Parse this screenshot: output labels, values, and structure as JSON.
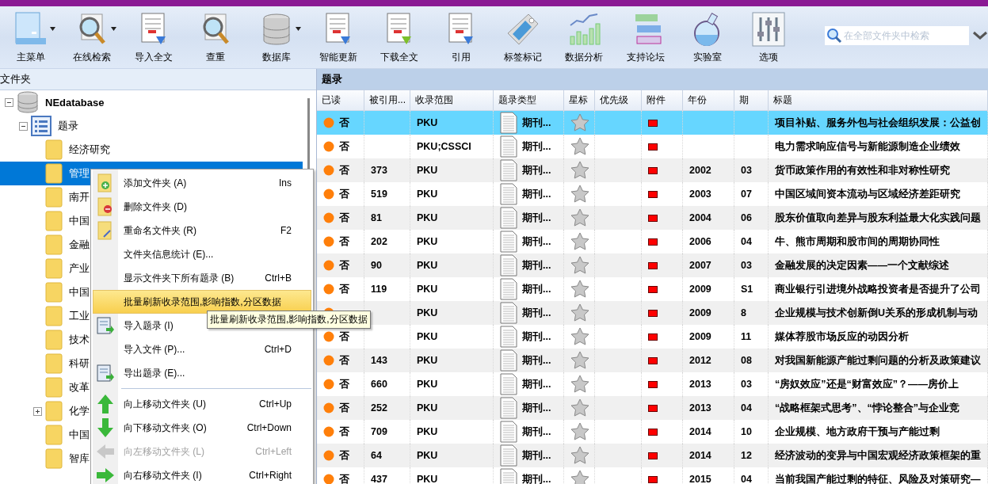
{
  "toolbar": {
    "buttons": [
      {
        "label": "主菜单",
        "dropdown": true
      },
      {
        "label": "在线检索",
        "dropdown": true
      },
      {
        "label": "导入全文",
        "dropdown": false
      },
      {
        "label": "查重",
        "dropdown": false
      },
      {
        "label": "数据库",
        "dropdown": true
      },
      {
        "label": "智能更新",
        "dropdown": false
      },
      {
        "label": "下载全文",
        "dropdown": false
      },
      {
        "label": "引用",
        "dropdown": false
      },
      {
        "label": "标签标记",
        "dropdown": false
      },
      {
        "label": "数据分析",
        "dropdown": false
      },
      {
        "label": "支持论坛",
        "dropdown": false
      },
      {
        "label": "实验室",
        "dropdown": false
      },
      {
        "label": "选项",
        "dropdown": false
      }
    ],
    "search": {
      "placeholder": "在全部文件夹中检索"
    }
  },
  "folder_panel": {
    "title": "文件夹",
    "tree": [
      {
        "label": "NEdatabase",
        "expanded": true,
        "selected": false,
        "children": [
          {
            "label": "题录",
            "expanded": true,
            "selected": false,
            "children": [
              {
                "label": "经济研究",
                "selected": false
              },
              {
                "label": "管理",
                "selected": true
              },
              {
                "label": "南开",
                "selected": false
              },
              {
                "label": "中国",
                "selected": false
              },
              {
                "label": "金融",
                "selected": false
              },
              {
                "label": "产业",
                "selected": false
              },
              {
                "label": "中国",
                "selected": false
              },
              {
                "label": "工业",
                "selected": false
              },
              {
                "label": "技术",
                "selected": false
              },
              {
                "label": "科研",
                "selected": false
              },
              {
                "label": "改革",
                "selected": false
              },
              {
                "label": "化学",
                "expanded": false,
                "selected": false
              },
              {
                "label": "中国",
                "selected": false
              },
              {
                "label": "智库",
                "selected": false
              }
            ]
          }
        ]
      }
    ]
  },
  "context_menu": {
    "items": [
      {
        "kind": "item",
        "label": "添加文件夹 (A)",
        "shortcut": "Ins",
        "selected": false,
        "disabled": false
      },
      {
        "kind": "item",
        "label": "删除文件夹 (D)",
        "selected": false,
        "disabled": false
      },
      {
        "kind": "item",
        "label": "重命名文件夹 (R)",
        "shortcut": "F2",
        "selected": false,
        "disabled": false
      },
      {
        "kind": "item",
        "label": "文件夹信息统计 (E)...",
        "selected": false,
        "disabled": false
      },
      {
        "kind": "item",
        "label": "显示文件夹下所有题录 (B)",
        "shortcut": "Ctrl+B",
        "selected": false,
        "disabled": false
      },
      {
        "kind": "item",
        "label": "批量刷新收录范围,影响指数,分区数据",
        "selected": true,
        "disabled": false
      },
      {
        "kind": "item",
        "label": "导入题录 (I)",
        "selected": false,
        "disabled": false
      },
      {
        "kind": "item",
        "label": "导入文件 (P)...",
        "shortcut": "Ctrl+D",
        "selected": false,
        "disabled": false
      },
      {
        "kind": "item",
        "label": "导出题录 (E)...",
        "selected": false,
        "disabled": false
      },
      {
        "kind": "separator"
      },
      {
        "kind": "item",
        "label": "向上移动文件夹 (U)",
        "shortcut": "Ctrl+Up",
        "selected": false,
        "disabled": false
      },
      {
        "kind": "item",
        "label": "向下移动文件夹 (O)",
        "shortcut": "Ctrl+Down",
        "selected": false,
        "disabled": false
      },
      {
        "kind": "item",
        "label": "向左移动文件夹 (L)",
        "shortcut": "Ctrl+Left",
        "selected": false,
        "disabled": true
      },
      {
        "kind": "item",
        "label": "向右移动文件夹 (I)",
        "shortcut": "Ctrl+Right",
        "selected": false,
        "disabled": false
      }
    ]
  },
  "tooltip": {
    "text": "批量刷新收录范围,影响指数,分区数据"
  },
  "records": {
    "title": "题录",
    "columns": [
      "已读",
      "被引用...",
      "收录范围",
      "题录类型",
      "星标",
      "优先级",
      "附件",
      "年份",
      "期",
      "标题"
    ],
    "rows": [
      {
        "read": "否",
        "scope": "PKU",
        "type": "期刊...",
        "starred": false,
        "attachment": true,
        "title": "项目补贴、服务外包与社会组织发展：公益创",
        "selected": true
      },
      {
        "read": "否",
        "scope": "PKU;CSSCI",
        "type": "期刊...",
        "starred": false,
        "attachment": true,
        "title": "电力需求响应信号与新能源制造企业绩效",
        "selected": false
      },
      {
        "read": "否",
        "cited": "373",
        "scope": "PKU",
        "type": "期刊...",
        "starred": false,
        "attachment": true,
        "year": "2002",
        "issue": "03",
        "title": "货币政策作用的有效性和非对称性研究",
        "selected": false
      },
      {
        "read": "否",
        "cited": "519",
        "scope": "PKU",
        "type": "期刊...",
        "starred": false,
        "attachment": true,
        "year": "2003",
        "issue": "07",
        "title": "中国区域间资本流动与区域经济差距研究",
        "selected": false
      },
      {
        "read": "否",
        "cited": "81",
        "scope": "PKU",
        "type": "期刊...",
        "starred": false,
        "attachment": true,
        "year": "2004",
        "issue": "06",
        "title": "股东价值取向差异与股东利益最大化实践问题",
        "selected": false
      },
      {
        "read": "否",
        "cited": "202",
        "scope": "PKU",
        "type": "期刊...",
        "starred": false,
        "attachment": true,
        "year": "2006",
        "issue": "04",
        "title": "牛、熊市周期和股市间的周期协同性",
        "selected": false
      },
      {
        "read": "否",
        "cited": "90",
        "scope": "PKU",
        "type": "期刊...",
        "starred": false,
        "attachment": true,
        "year": "2007",
        "issue": "03",
        "title": "金融发展的决定因素——一个文献综述",
        "selected": false
      },
      {
        "read": "否",
        "cited": "119",
        "scope": "PKU",
        "type": "期刊...",
        "starred": false,
        "attachment": true,
        "year": "2009",
        "issue": "S1",
        "title": "商业银行引进境外战略投资者是否提升了公司",
        "selected": false
      },
      {
        "scope": "PKU",
        "type": "期刊...",
        "starred": false,
        "attachment": true,
        "year": "2009",
        "issue": "8",
        "title": "企业规模与技术创新倒U关系的形成机制与动",
        "selected": false
      },
      {
        "read": "否",
        "scope": "PKU",
        "type": "期刊...",
        "starred": false,
        "attachment": true,
        "year": "2009",
        "issue": "11",
        "title": "媒体荐股市场反应的动因分析",
        "selected": false
      },
      {
        "read": "否",
        "cited": "143",
        "scope": "PKU",
        "type": "期刊...",
        "starred": false,
        "attachment": true,
        "year": "2012",
        "issue": "08",
        "title": "对我国新能源产能过剩问题的分析及政策建议",
        "selected": false
      },
      {
        "read": "否",
        "cited": "660",
        "scope": "PKU",
        "type": "期刊...",
        "starred": false,
        "attachment": true,
        "year": "2013",
        "issue": "03",
        "title": "“房奴效应”还是“财富效应”？——房价上",
        "selected": false
      },
      {
        "read": "否",
        "cited": "252",
        "scope": "PKU",
        "type": "期刊...",
        "starred": false,
        "attachment": true,
        "year": "2013",
        "issue": "04",
        "title": "“战略框架式思考”、“悖论整合”与企业竞",
        "selected": false
      },
      {
        "read": "否",
        "cited": "709",
        "scope": "PKU",
        "type": "期刊...",
        "starred": false,
        "attachment": true,
        "year": "2014",
        "issue": "10",
        "title": "企业规模、地方政府干预与产能过剩",
        "selected": false
      },
      {
        "read": "否",
        "cited": "64",
        "scope": "PKU",
        "type": "期刊...",
        "starred": false,
        "attachment": true,
        "year": "2014",
        "issue": "12",
        "title": "经济波动的变异与中国宏观经济政策框架的重",
        "selected": false
      },
      {
        "read": "否",
        "cited": "437",
        "scope": "PKU",
        "type": "期刊...",
        "starred": false,
        "attachment": true,
        "year": "2015",
        "issue": "04",
        "title": "当前我国产能过剩的特征、风险及对策研究—",
        "selected": false
      }
    ]
  }
}
